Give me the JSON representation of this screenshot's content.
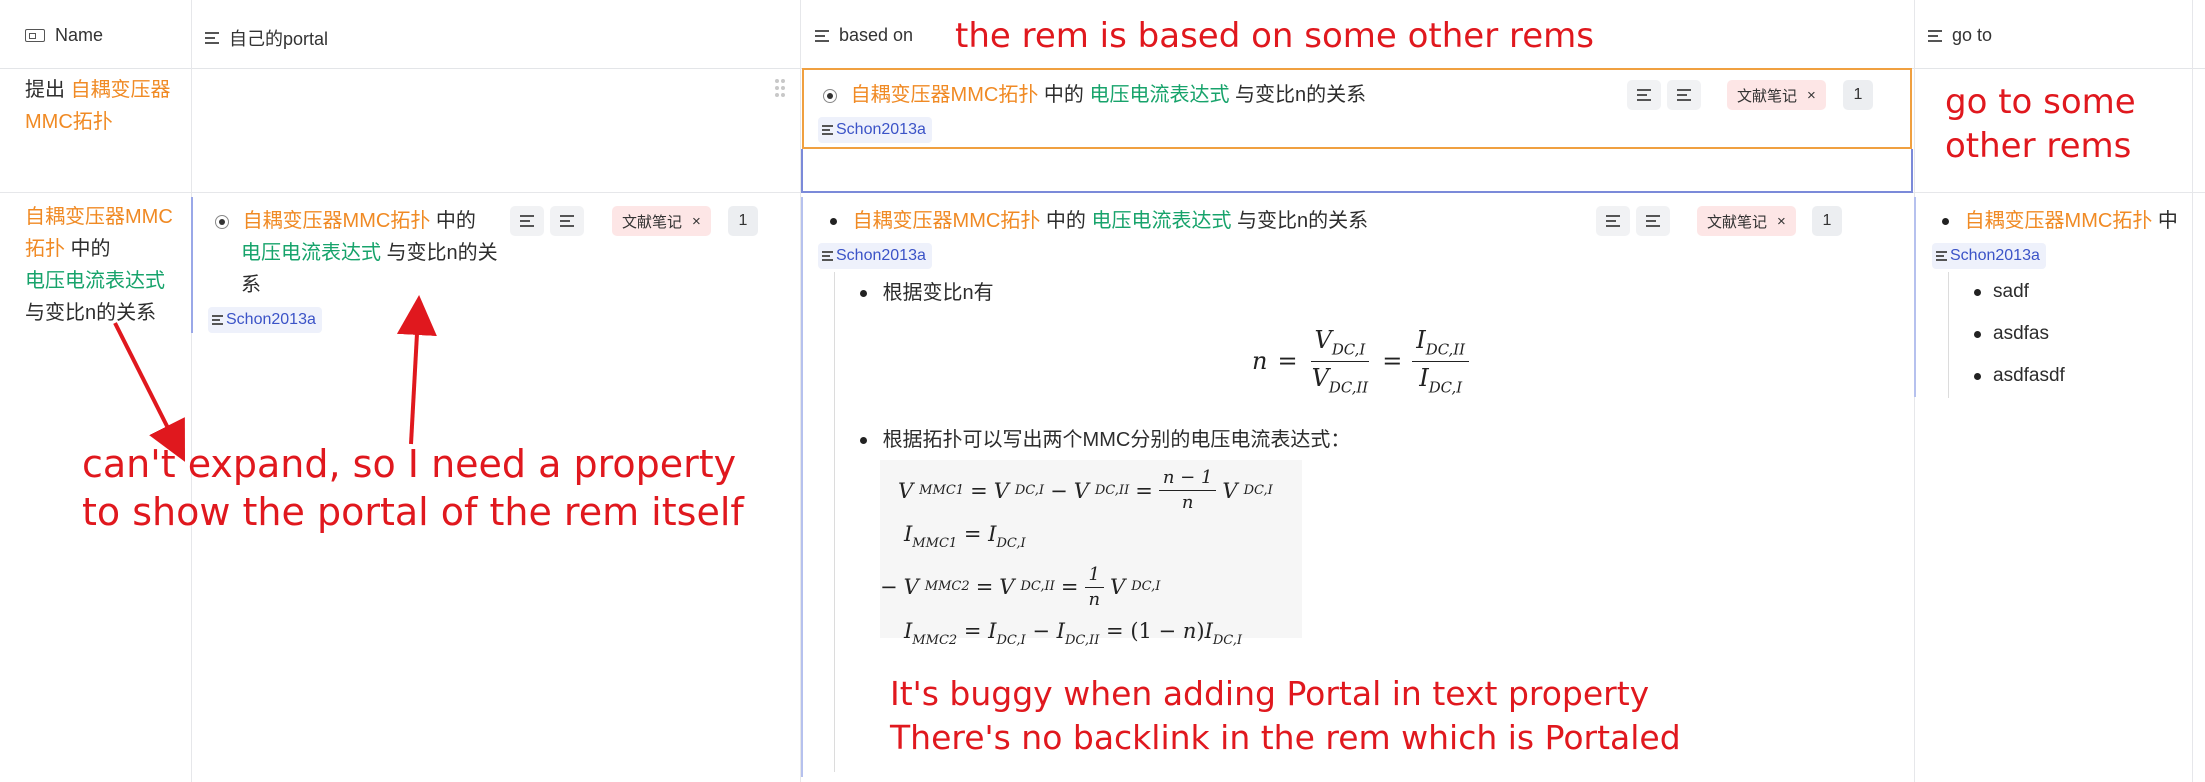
{
  "header": {
    "col_name": "Name",
    "col_portal": "自己的portal",
    "col_based_on": "based on",
    "col_go_to": "go to"
  },
  "row1": {
    "name_prefix": "提出 ",
    "name_link": "自耦变压器MMC拓扑",
    "based_on": {
      "link1": "自耦变压器MMC拓扑",
      "mid": " 中的 ",
      "link2": "电压电流表达式",
      "tail": " 与变比n的关系",
      "tag": "文献笔记",
      "tag_close": "×",
      "count": "1",
      "ref": "Schon2013a"
    }
  },
  "row2": {
    "name_link1": "自耦变压器MMC拓扑",
    "name_mid": " 中的",
    "name_link2": "电压电流表达式",
    "name_tail": "与变比n的关系",
    "portal": {
      "link1": "自耦变压器MMC拓扑",
      "mid": " 中的",
      "link2": "电压电流表达式",
      "tail1": " 与变比n的关",
      "tail2": "系",
      "tag": "文献笔记",
      "tag_close": "×",
      "count": "1",
      "ref": "Schon2013a"
    },
    "based_on": {
      "link1": "自耦变压器MMC拓扑",
      "mid": " 中的 ",
      "link2": "电压电流表达式",
      "tail": " 与变比n的关系",
      "tag": "文献笔记",
      "tag_close": "×",
      "count": "1",
      "ref": "Schon2013a",
      "child1": "根据变比n有",
      "child2": "根据拓扑可以写出两个MMC分别的电压电流表达式："
    },
    "go_to": {
      "link1": "自耦变压器MMC拓扑",
      "mid": " 中",
      "ref": "Schon2013a",
      "items": [
        "sadf",
        "asdfas",
        "asdfasdf"
      ]
    }
  },
  "annotations": {
    "based_on_note": "the rem is based on some other rems",
    "go_to_note_1": "go to some",
    "go_to_note_2": "other rems",
    "cant_expand_1": "can't expand, so I need a property",
    "cant_expand_2": "to show the portal of the rem itself",
    "buggy_1": "It's buggy when adding Portal in text property",
    "buggy_2": "There's no backlink in the rem which is Portaled"
  },
  "colors": {
    "link_orange": "#f08a24",
    "link_green": "#17a36b",
    "annotation_red": "#e0181e",
    "focus_orange": "#f0a040",
    "selection_blue": "#7b8ad9"
  }
}
